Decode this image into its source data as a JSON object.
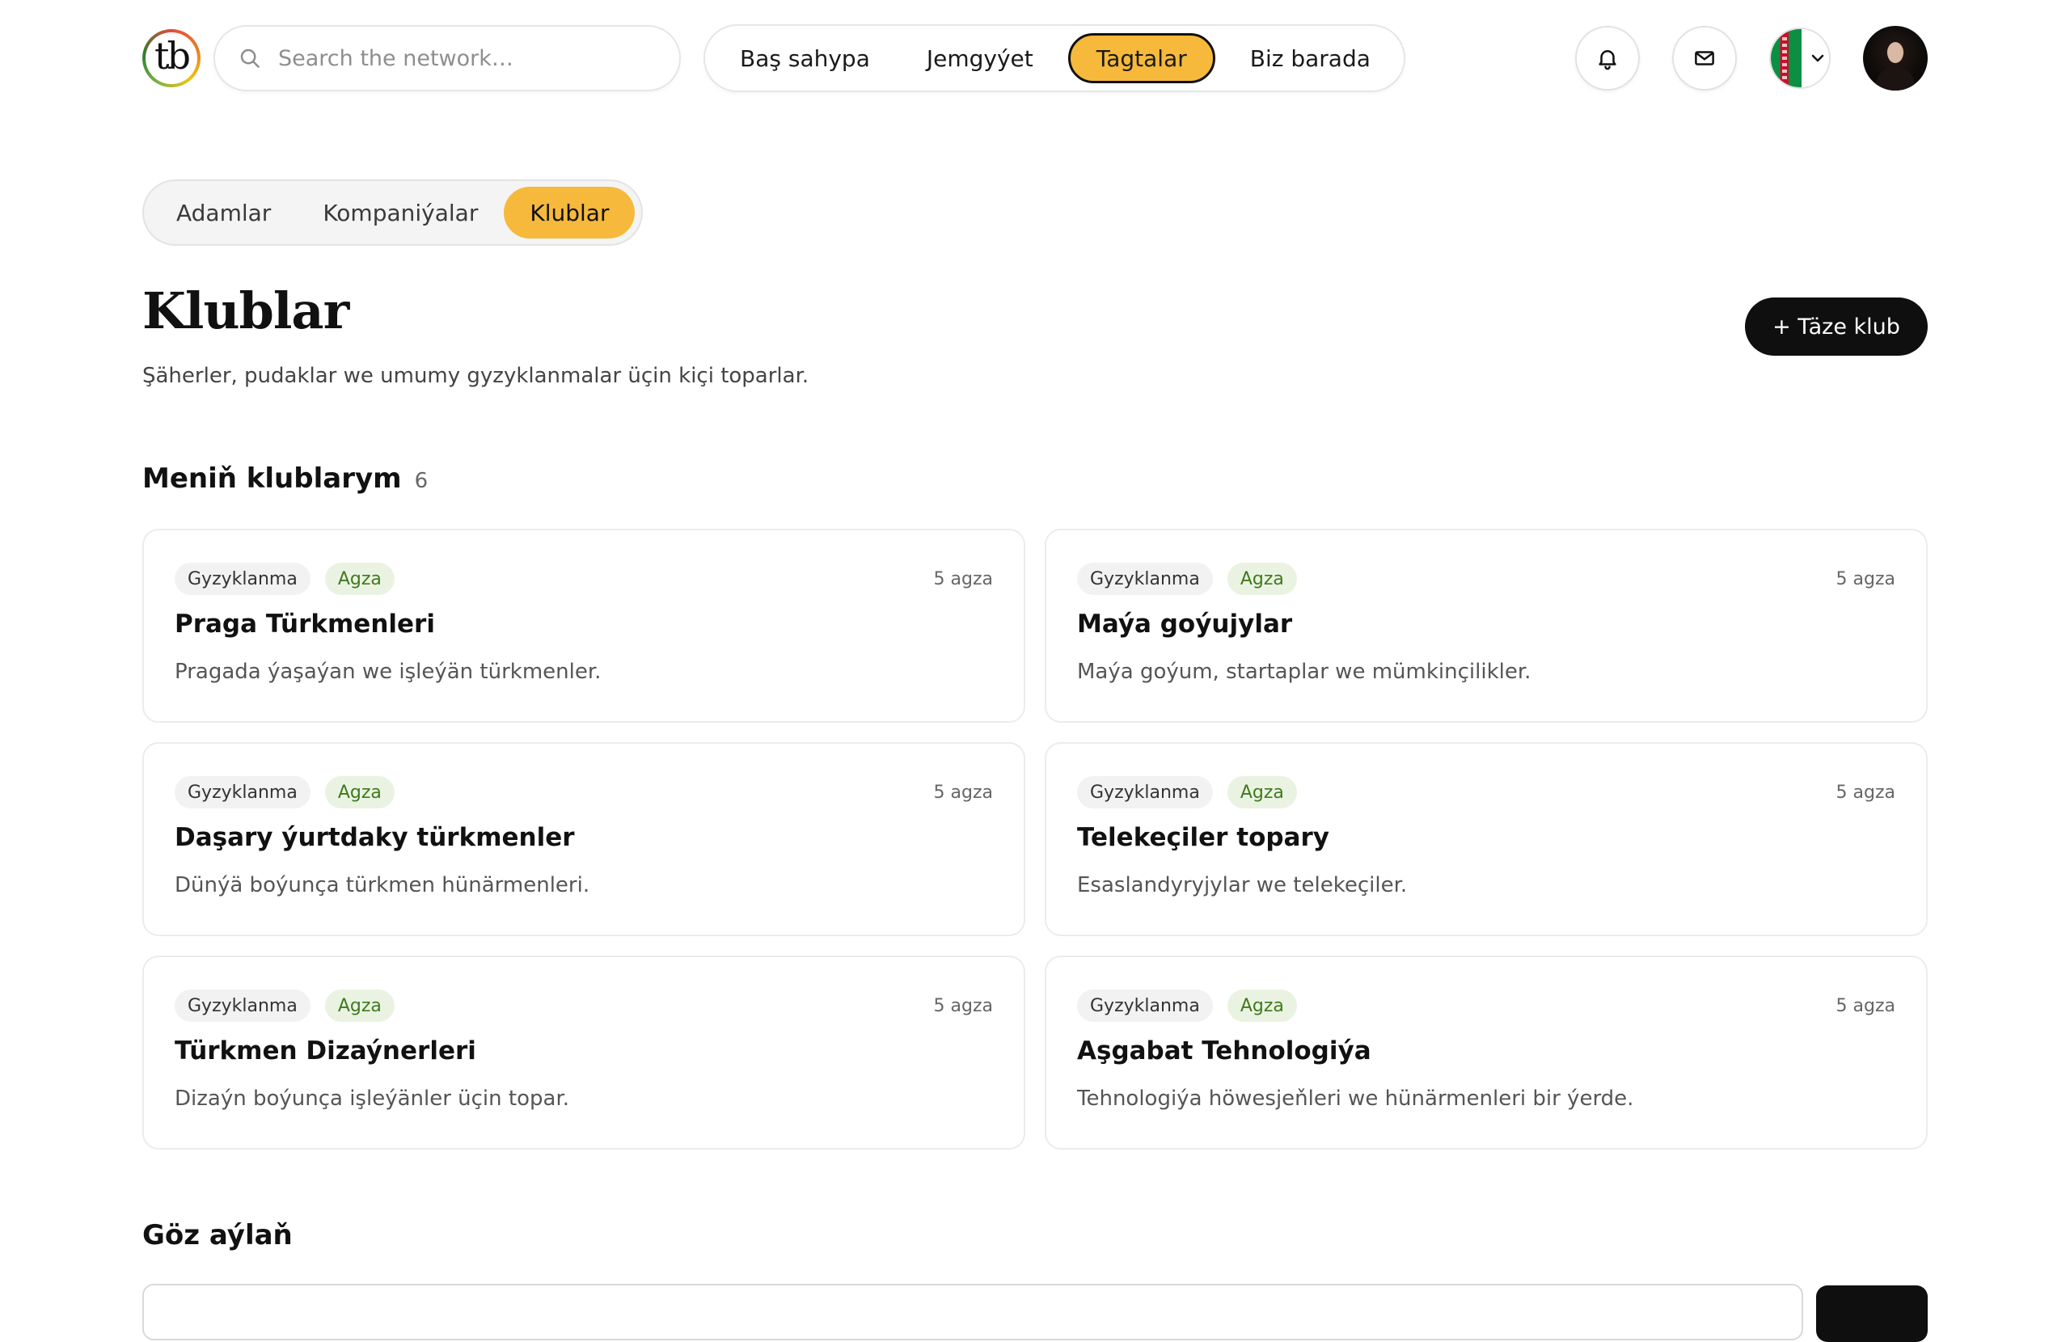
{
  "header": {
    "logo_text": "tb",
    "search_placeholder": "Search the network…",
    "nav": [
      {
        "label": "Baş sahypa",
        "active": false
      },
      {
        "label": "Jemgyýet",
        "active": false
      },
      {
        "label": "Tagtalar",
        "active": true
      },
      {
        "label": "Biz barada",
        "active": false
      }
    ],
    "icons": [
      "bell-icon",
      "mail-icon",
      "chevron-down-icon"
    ]
  },
  "subtabs": [
    {
      "label": "Adamlar",
      "active": false
    },
    {
      "label": "Kompaniýalar",
      "active": false
    },
    {
      "label": "Klublar",
      "active": true
    }
  ],
  "page": {
    "title": "Klublar",
    "subtitle": "Şäherler, pudaklar we umumy gyzyklanmalar üçin kiçi toparlar.",
    "new_button": "+ Täze klub"
  },
  "my_clubs": {
    "title": "Meniň klublarym",
    "count": "6",
    "cards": [
      {
        "type": "Gyzyklanma",
        "role": "Agza",
        "members": "5 agza",
        "title": "Praga Türkmenleri",
        "desc": "Pragada ýaşaýan we işleýän türkmenler."
      },
      {
        "type": "Gyzyklanma",
        "role": "Agza",
        "members": "5 agza",
        "title": "Maýa goýujylar",
        "desc": "Maýa goýum, startaplar we mümkinçilikler."
      },
      {
        "type": "Gyzyklanma",
        "role": "Agza",
        "members": "5 agza",
        "title": "Daşary ýurtdaky türkmenler",
        "desc": "Dünýä boýunça türkmen hünärmenleri."
      },
      {
        "type": "Gyzyklanma",
        "role": "Agza",
        "members": "5 agza",
        "title": "Telekeçiler topary",
        "desc": "Esaslandyryjylar we telekeçiler."
      },
      {
        "type": "Gyzyklanma",
        "role": "Agza",
        "members": "5 agza",
        "title": "Türkmen Dizaýnerleri",
        "desc": "Dizaýn boýunça işleýänler üçin topar."
      },
      {
        "type": "Gyzyklanma",
        "role": "Agza",
        "members": "5 agza",
        "title": "Aşgabat Tehnologiýa",
        "desc": "Tehnologiýa höwesjeňleri we hünärmenleri bir ýerde."
      }
    ]
  },
  "explore": {
    "title": "Göz aýlaň"
  },
  "colors": {
    "accent": "#f6b93b",
    "dark": "#0f0f0f",
    "member_tag_bg": "#eaf3e2",
    "member_tag_text": "#3f7a1e"
  }
}
